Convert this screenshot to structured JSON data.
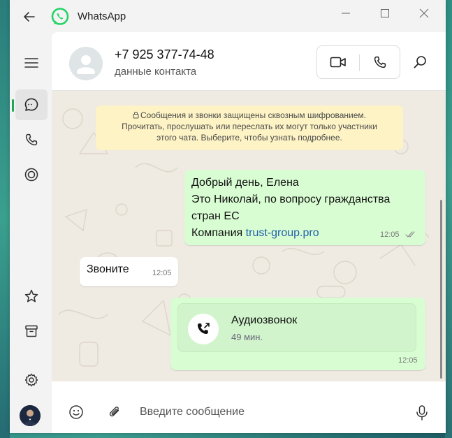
{
  "app": {
    "title": "WhatsApp",
    "brand_color": "#25d366",
    "active_color": "#1fa855"
  },
  "titlebar": {
    "back_icon": "arrow-left-icon",
    "minimize_icon": "minimize-icon",
    "maximize_icon": "maximize-icon",
    "close_icon": "close-icon"
  },
  "sidebar": {
    "items": [
      {
        "name": "menu",
        "icon": "hamburger-icon"
      },
      {
        "name": "chats",
        "icon": "chat-bubble-icon",
        "active": true
      },
      {
        "name": "calls",
        "icon": "phone-icon"
      },
      {
        "name": "status",
        "icon": "status-ring-icon"
      },
      {
        "name": "starred",
        "icon": "star-icon"
      },
      {
        "name": "archived",
        "icon": "archive-icon"
      },
      {
        "name": "settings",
        "icon": "gear-icon"
      },
      {
        "name": "profile",
        "icon": "avatar"
      }
    ]
  },
  "header": {
    "contact_name": "+7 925 377-74-48",
    "contact_sub": "данные контакта",
    "video_icon": "video-camera-icon",
    "voice_icon": "phone-icon",
    "search_icon": "search-icon"
  },
  "chat": {
    "encryption_notice_lines": [
      "Сообщения и звонки защищены сквозным шифрованием.",
      "Прочитать, прослушать или переслать их могут только участники",
      "этого чата. Выберите, чтобы узнать подробнее."
    ],
    "messages": [
      {
        "direction": "outgoing",
        "lines": [
          "Добрый день, Елена",
          "Это Николай, по вопросу гражданства",
          "стран ЕС"
        ],
        "link_prefix": "Компания ",
        "link_text": "trust-group.pro",
        "time": "12:05",
        "status": "read"
      },
      {
        "direction": "incoming",
        "text": "Звоните",
        "time": "12:05"
      },
      {
        "direction": "outgoing",
        "call_title": "Аудиозвонок",
        "call_duration": "49 мин.",
        "time": "12:05"
      }
    ]
  },
  "composer": {
    "placeholder": "Введите сообщение",
    "value": "",
    "emoji_icon": "emoji-icon",
    "attach_icon": "paperclip-icon",
    "mic_icon": "microphone-icon"
  },
  "colors": {
    "outgoing_bubble": "#d9fdd3",
    "incoming_bubble": "#ffffff",
    "chat_background": "#efeae2",
    "notice_background": "#fdf3c5",
    "link": "#1f5fa8"
  }
}
